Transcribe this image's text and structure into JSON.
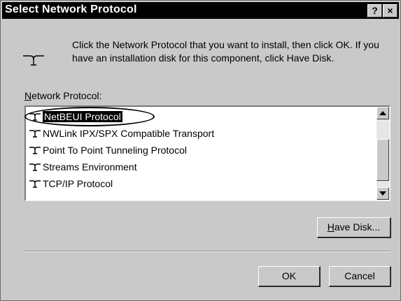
{
  "window": {
    "title": "Select Network Protocol",
    "help_label": "?",
    "close_label": "×"
  },
  "header": {
    "icon": "network-protocol-icon",
    "instruction": "Click the Network Protocol that you want to install, then click OK.  If you have an installation disk for this component, click Have Disk."
  },
  "list": {
    "label_accel": "N",
    "label_rest": "etwork Protocol:",
    "item_icon": "network-protocol-icon",
    "selected_index": 0,
    "items": [
      "NetBEUI Protocol",
      "NWLink IPX/SPX Compatible Transport",
      "Point To Point Tunneling Protocol",
      "Streams Environment",
      "TCP/IP Protocol"
    ]
  },
  "buttons": {
    "have_disk_accel": "H",
    "have_disk_rest": "ave Disk...",
    "ok": "OK",
    "cancel": "Cancel"
  },
  "colors": {
    "dialog_bg": "#c9c9c9",
    "titlebar_bg": "#000000",
    "selection_bg": "#000000",
    "list_bg": "#ffffff"
  }
}
